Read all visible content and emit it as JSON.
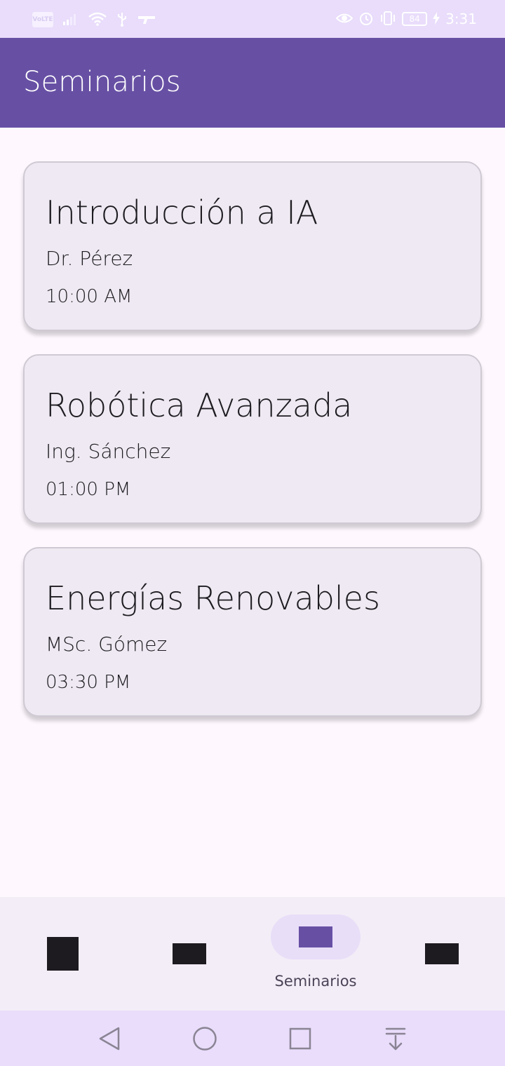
{
  "status_bar": {
    "volte": "VoLTE",
    "battery": "84",
    "time": "3:31"
  },
  "app_bar": {
    "title": "Seminarios"
  },
  "seminars": [
    {
      "title": "Introducción a IA",
      "speaker": "Dr. Pérez",
      "time": "10:00 AM"
    },
    {
      "title": "Robótica Avanzada",
      "speaker": "Ing. Sánchez",
      "time": "01:00 PM"
    },
    {
      "title": "Energías Renovables",
      "speaker": "MSc. Gómez",
      "time": "03:30 PM"
    }
  ],
  "bottom_nav": {
    "active_label": "Seminarios"
  },
  "colors": {
    "primary": "#6750a4",
    "status_bar": "#e9ddfb",
    "card_bg": "#eee9f2",
    "nav_pill": "#e8def8"
  }
}
